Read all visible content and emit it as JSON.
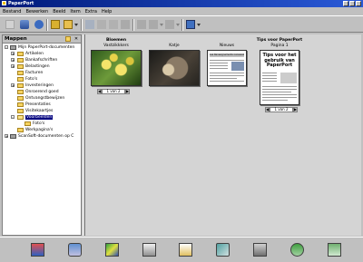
{
  "window": {
    "title": "PaperPort"
  },
  "menu": [
    "Bestand",
    "Bewerken",
    "Beeld",
    "Item",
    "Extra",
    "Help"
  ],
  "toolbar": {
    "icons": [
      "new-icon",
      "scan-icon",
      "folder-view-icon",
      "page-view-icon",
      "print-icon",
      "cut-icon",
      "copy-icon",
      "paste-icon",
      "undo-icon",
      "redo-icon",
      "annotate-icon",
      "view-mode-icon"
    ]
  },
  "folders_panel": {
    "title": "Mappen",
    "items": [
      {
        "label": "Mijn PaperPort-documenten",
        "type": "drive"
      },
      {
        "label": "Artikelen",
        "type": "folder"
      },
      {
        "label": "Bankafschriften",
        "type": "folder"
      },
      {
        "label": "Belastingen",
        "type": "folder"
      },
      {
        "label": "Facturen",
        "type": "folder"
      },
      {
        "label": "Foto's",
        "type": "folder"
      },
      {
        "label": "Investeringen",
        "type": "folder"
      },
      {
        "label": "Onroerend goed",
        "type": "folder"
      },
      {
        "label": "Ontvangstbewijzen",
        "type": "folder"
      },
      {
        "label": "Presentaties",
        "type": "folder"
      },
      {
        "label": "Visitekaartjes",
        "type": "folder"
      },
      {
        "label": "Voorbeelden",
        "type": "folder",
        "selected": true
      },
      {
        "label": "Foto's",
        "type": "folder"
      },
      {
        "label": "Werkpagina's",
        "type": "folder"
      },
      {
        "label": "ScanSoft-documenten op C",
        "type": "drive"
      }
    ]
  },
  "items": [
    {
      "title": "Bloemen",
      "subtitle": "Vastzikkkers",
      "pager": "1 van 2"
    },
    {
      "title": "",
      "subtitle": "Katje",
      "pager": ""
    },
    {
      "title": "",
      "subtitle": "Nieuws",
      "pager": ""
    },
    {
      "title": "Tips voor PaperPort",
      "subtitle": "Pagina 1",
      "pager": "1 van 2"
    }
  ],
  "tips_doc": {
    "heading": "Tips voor het gebruik van PaperPort"
  },
  "news_doc": {
    "heading": "Les Renseignements nécessaires"
  },
  "bottom_apps": [
    "fax-icon",
    "mail-icon",
    "paint-icon",
    "office-icon",
    "word-icon",
    "scan-document-icon",
    "print-app-icon",
    "ftp-icon",
    "recycle-icon"
  ],
  "colors": {
    "titlebar": "#001a7a",
    "selection": "#000080",
    "background": "#c0c0c0"
  }
}
